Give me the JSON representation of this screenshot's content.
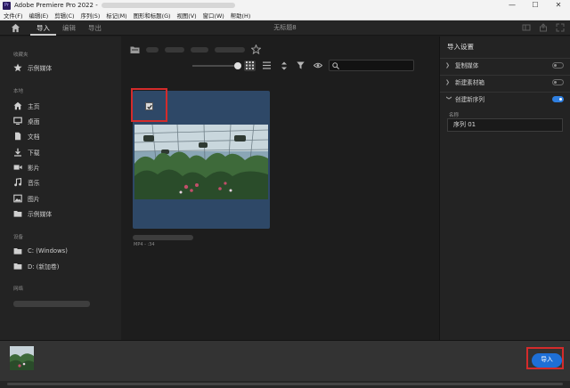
{
  "window": {
    "app_badge": "Pr",
    "title": "Adobe Premiere Pro 2022 - ",
    "controls": {
      "minimize": "—",
      "maximize": "☐",
      "close": "✕"
    }
  },
  "menu": [
    "文件(F)",
    "编辑(E)",
    "剪辑(C)",
    "序列(S)",
    "标记(M)",
    "图形和标题(G)",
    "视图(V)",
    "窗口(W)",
    "帮助(H)"
  ],
  "header": {
    "tabs": [
      "导入",
      "编辑",
      "导出"
    ],
    "active_tab": "导入",
    "doc_title": "无标题8"
  },
  "sidebar": {
    "favorites_label": "收藏夹",
    "favorites": [
      {
        "label": "示例媒体",
        "icon": "star-icon"
      }
    ],
    "local_label": "本地",
    "local": [
      {
        "label": "主页",
        "icon": "home-icon"
      },
      {
        "label": "桌面",
        "icon": "monitor-icon"
      },
      {
        "label": "文档",
        "icon": "document-icon"
      },
      {
        "label": "下载",
        "icon": "download-icon"
      },
      {
        "label": "影片",
        "icon": "video-icon"
      },
      {
        "label": "音乐",
        "icon": "music-icon"
      },
      {
        "label": "图片",
        "icon": "image-icon"
      },
      {
        "label": "示例媒体",
        "icon": "folder-icon"
      }
    ],
    "devices_label": "设备",
    "devices": [
      {
        "label": "C: (Windows)",
        "icon": "drive-folder-icon"
      },
      {
        "label": "D: (新加卷)",
        "icon": "drive-folder-icon"
      }
    ],
    "network_label": "网络"
  },
  "main": {
    "search": {
      "value": "",
      "placeholder": ""
    },
    "file": {
      "meta": "MP4 - :34"
    }
  },
  "import_settings": {
    "title": "导入设置",
    "options": [
      {
        "label": "复制媒体",
        "on": false
      },
      {
        "label": "新建素材箱",
        "on": false
      },
      {
        "label": "创建新序列",
        "on": true
      }
    ],
    "name_label": "名称",
    "name_value": "序列 01"
  },
  "bottom": {
    "import_button": "导入"
  },
  "colors": {
    "accent": "#1e6fd6",
    "card": "#2e4867",
    "highlight_box": "#d42b2b"
  }
}
